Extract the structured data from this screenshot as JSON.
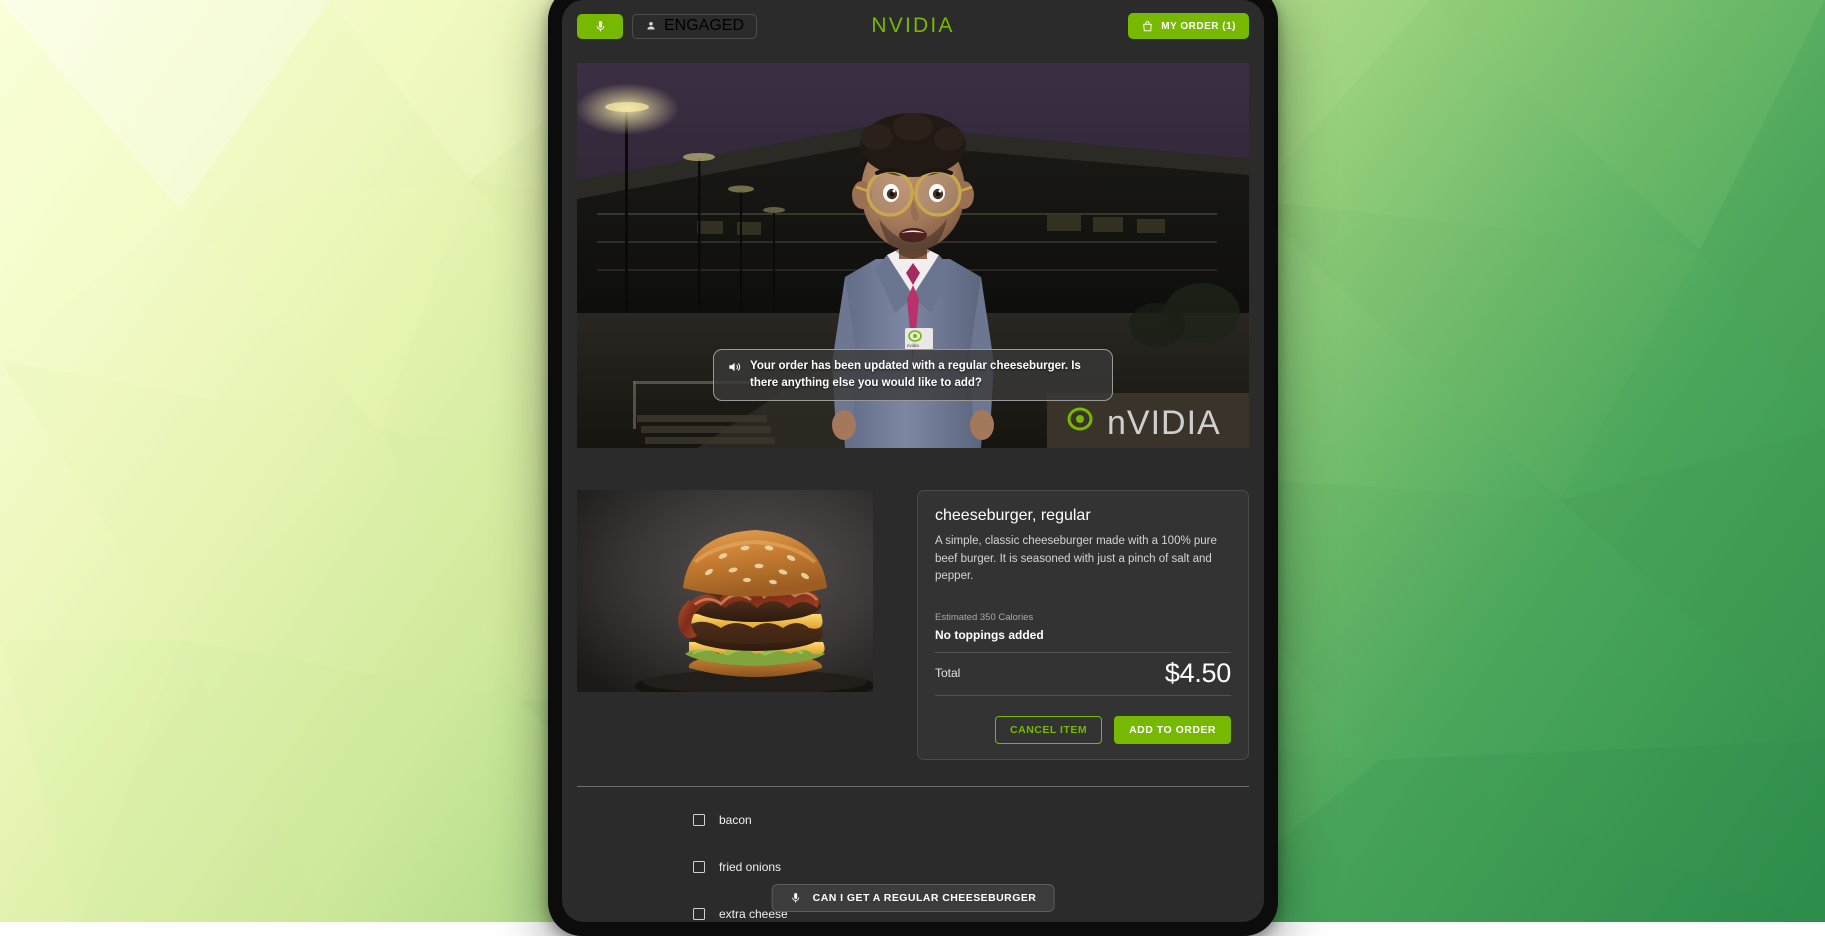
{
  "header": {
    "mic_icon": "microphone-icon",
    "engagement_status": "ENGAGED",
    "engagement_icon": "person-icon",
    "brand": "NVIDIA",
    "order_button_label": "MY ORDER (1)",
    "order_icon": "shopping-bag-icon",
    "accent_green": "#76b900",
    "panel_bg": "#2b2b2b"
  },
  "avatar": {
    "caption": "Your order has been updated with a regular cheeseburger. Is there anything else you would like to add?",
    "caption_icon": "speaker-icon",
    "scene_sign": "nVIDIA"
  },
  "product": {
    "image_alt": "cheeseburger-photo",
    "title": "cheeseburger, regular",
    "description": "A simple, classic cheeseburger made with a 100% pure beef burger. It is seasoned with just a pinch of salt and pepper.",
    "calories": "Estimated 350 Calories",
    "toppings_summary": "No toppings added",
    "total_label": "Total",
    "total_value": "$4.50",
    "cancel_label": "CANCEL ITEM",
    "add_label": "ADD TO ORDER"
  },
  "toppings": [
    {
      "label": "bacon",
      "checked": false
    },
    {
      "label": "fried onions",
      "checked": false
    },
    {
      "label": "extra cheese",
      "checked": false
    }
  ],
  "voice": {
    "transcript": "CAN I GET A REGULAR CHEESEBURGER",
    "mic_icon": "microphone-icon"
  }
}
